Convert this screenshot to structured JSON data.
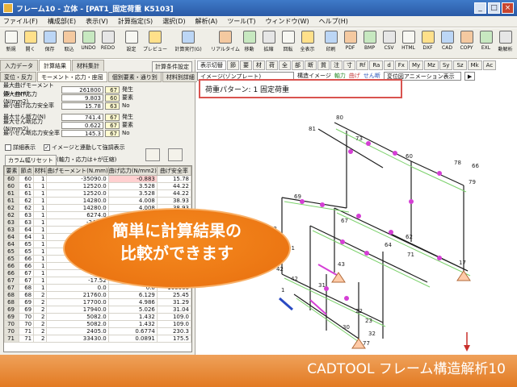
{
  "window": {
    "title": "フレーム10 - 立体 - [PAT1_固定荷重 K5103]",
    "min": "_",
    "max": "□",
    "close": "×"
  },
  "menu": [
    "ファイル(F)",
    "構成部(E)",
    "表示(V)",
    "計算指定(S)",
    "選択(D)",
    "解析(A)",
    "ツール(T)",
    "ウィンドウ(W)",
    "ヘルプ(H)"
  ],
  "toolbar": [
    {
      "label": "新規",
      "icon": "new-file-icon"
    },
    {
      "label": "開く",
      "icon": "open-folder-icon"
    },
    {
      "label": "保存",
      "icon": "save-icon"
    },
    {
      "label": "取込",
      "icon": "import-icon"
    },
    {
      "label": "UNDO",
      "icon": "undo-icon"
    },
    {
      "label": "REDO",
      "icon": "redo-icon"
    },
    {
      "label": "設定",
      "icon": "settings-icon"
    },
    {
      "label": "プレビュー",
      "icon": "preview-icon"
    },
    {
      "label": "計算実行(G)",
      "icon": "calculate-icon"
    },
    {
      "label": "リアルタイム",
      "icon": "realtime-icon"
    },
    {
      "label": "移動",
      "icon": "move-icon"
    },
    {
      "label": "拡縮",
      "icon": "zoom-icon"
    },
    {
      "label": "回転",
      "icon": "rotate-icon"
    },
    {
      "label": "全表示",
      "icon": "fit-all-icon"
    },
    {
      "label": "印刷",
      "icon": "print-icon"
    },
    {
      "label": "PDF",
      "icon": "pdf-icon"
    },
    {
      "label": "BMP",
      "icon": "bmp-icon"
    },
    {
      "label": "CSV",
      "icon": "csv-icon"
    },
    {
      "label": "HTML",
      "icon": "html-icon"
    },
    {
      "label": "DXF",
      "icon": "dxf-icon"
    },
    {
      "label": "CAD",
      "icon": "cad-icon"
    },
    {
      "label": "COPY",
      "icon": "copy-icon"
    },
    {
      "label": "EXL",
      "icon": "excel-icon"
    },
    {
      "label": "動解析",
      "icon": "dynamic-analysis-icon"
    }
  ],
  "left": {
    "tabs1": [
      "入力データ",
      "計算結果",
      "材料集計"
    ],
    "cond_button": "計算条件設定",
    "tabs2": [
      "変位・反力",
      "モーメント・応力・座屈",
      "個別要素・通り別",
      "材料別詳細"
    ],
    "results": [
      {
        "label": "最大曲げモーメント(N・mm)",
        "value": "261800",
        "id": "67",
        "tag": "発生"
      },
      {
        "label": "最大曲げ応力(N/mm2)",
        "value": "9.803",
        "id": "60",
        "tag": "要素"
      },
      {
        "label": "最小曲げ応力安全率",
        "value": "15.78",
        "id": "63",
        "tag": "No"
      },
      {
        "label": "最大せん断力(N)",
        "value": "741.4",
        "id": "67",
        "tag": "発生"
      },
      {
        "label": "最大せん断応力(N/mm2)",
        "value": "0.622",
        "id": "67",
        "tag": "要素"
      },
      {
        "label": "最小せん断応力安全率",
        "value": "145.3",
        "id": "67",
        "tag": "No"
      }
    ],
    "opt_detail": "詳細表示",
    "opt_link": "イメージと連動して強調表示",
    "col_width_btn": "カラム幅リセット",
    "axial_note": "(軸力・応力は+が圧縮)",
    "columns": [
      "要素",
      "節点",
      "材料",
      "曲げモーメント(N.mm)",
      "曲げ応力(N/mm2)",
      "曲げ安全率"
    ],
    "rows": [
      [
        "60",
        "60",
        "1",
        "-35090.0",
        "-0.883",
        "15.78"
      ],
      [
        "60",
        "61",
        "1",
        "12520.0",
        "3.528",
        "44.22"
      ],
      [
        "61",
        "61",
        "1",
        "12520.0",
        "3.528",
        "44.22"
      ],
      [
        "61",
        "62",
        "1",
        "14280.0",
        "4.008",
        "38.93"
      ],
      [
        "62",
        "62",
        "1",
        "14280.0",
        "4.008",
        "38.93"
      ],
      [
        "62",
        "63",
        "1",
        "6274.0",
        "",
        ""
      ],
      [
        "63",
        "63",
        "1",
        "-24820",
        "",
        ""
      ],
      [
        "63",
        "64",
        "1",
        "",
        "",
        ""
      ],
      [
        "64",
        "64",
        "1",
        "",
        "",
        ""
      ],
      [
        "64",
        "65",
        "1",
        "",
        "",
        ""
      ],
      [
        "65",
        "65",
        "1",
        "",
        "",
        ""
      ],
      [
        "65",
        "66",
        "1",
        "-13000.0",
        "",
        ""
      ],
      [
        "66",
        "66",
        "1",
        "-13000.0",
        "",
        ""
      ],
      [
        "66",
        "67",
        "1",
        "-17.52",
        "-0.0049",
        "31680.0"
      ],
      [
        "67",
        "67",
        "1",
        "-17.52",
        "-0.0049",
        "31680.0"
      ],
      [
        "67",
        "68",
        "1",
        "0.0",
        "0.0",
        "100000"
      ],
      [
        "68",
        "68",
        "2",
        "21760.0",
        "6.129",
        "25.45"
      ],
      [
        "68",
        "69",
        "2",
        "17700.0",
        "4.986",
        "31.29"
      ],
      [
        "69",
        "69",
        "2",
        "17940.0",
        "5.026",
        "31.04"
      ],
      [
        "69",
        "70",
        "2",
        "5082.0",
        "1.432",
        "109.0"
      ],
      [
        "70",
        "70",
        "2",
        "5082.0",
        "1.432",
        "109.0"
      ],
      [
        "70",
        "71",
        "2",
        "2405.0",
        "0.6774",
        "230.3"
      ],
      [
        "71",
        "71",
        "2",
        "33430.0",
        "0.0891",
        "175.5"
      ]
    ]
  },
  "view": {
    "tabs": [
      "表示切替",
      "節",
      "要",
      "材",
      "荷",
      "全",
      "部",
      "断",
      "質",
      "注",
      "寸",
      "Rf",
      "Ra",
      "d",
      "Fx",
      "My",
      "Mz",
      "Sy",
      "Sz",
      "Mk",
      "Ac"
    ],
    "image_label": "イメージ(ゾンプレート)",
    "struct_label": "構造イメージ",
    "axial": "軸力",
    "bend": "曲げ",
    "shear": "せん断",
    "disp_mode": "変位図アニメーション表示",
    "arrow": "▶"
  },
  "load_pattern": "荷重パターン: 1 固定荷重",
  "node_labels": [
    "80",
    "81",
    "79",
    "78",
    "77",
    "69",
    "60",
    "62",
    "64",
    "67",
    "66",
    "71",
    "73",
    "72",
    "91",
    "31",
    "1",
    "17",
    "42",
    "42",
    "43",
    "22",
    "23",
    "30",
    "32"
  ],
  "callout": {
    "line1": "簡単に計算結果の",
    "line2": "比較ができます"
  },
  "banner": "CADTOOL フレーム構造解析10",
  "colors": {
    "accent": "#e8731a",
    "title_blue": "#2a5aa6",
    "frame_line": "#1e1e1e",
    "member_green": "#7bd16b",
    "node_magenta": "#d53fd5"
  }
}
